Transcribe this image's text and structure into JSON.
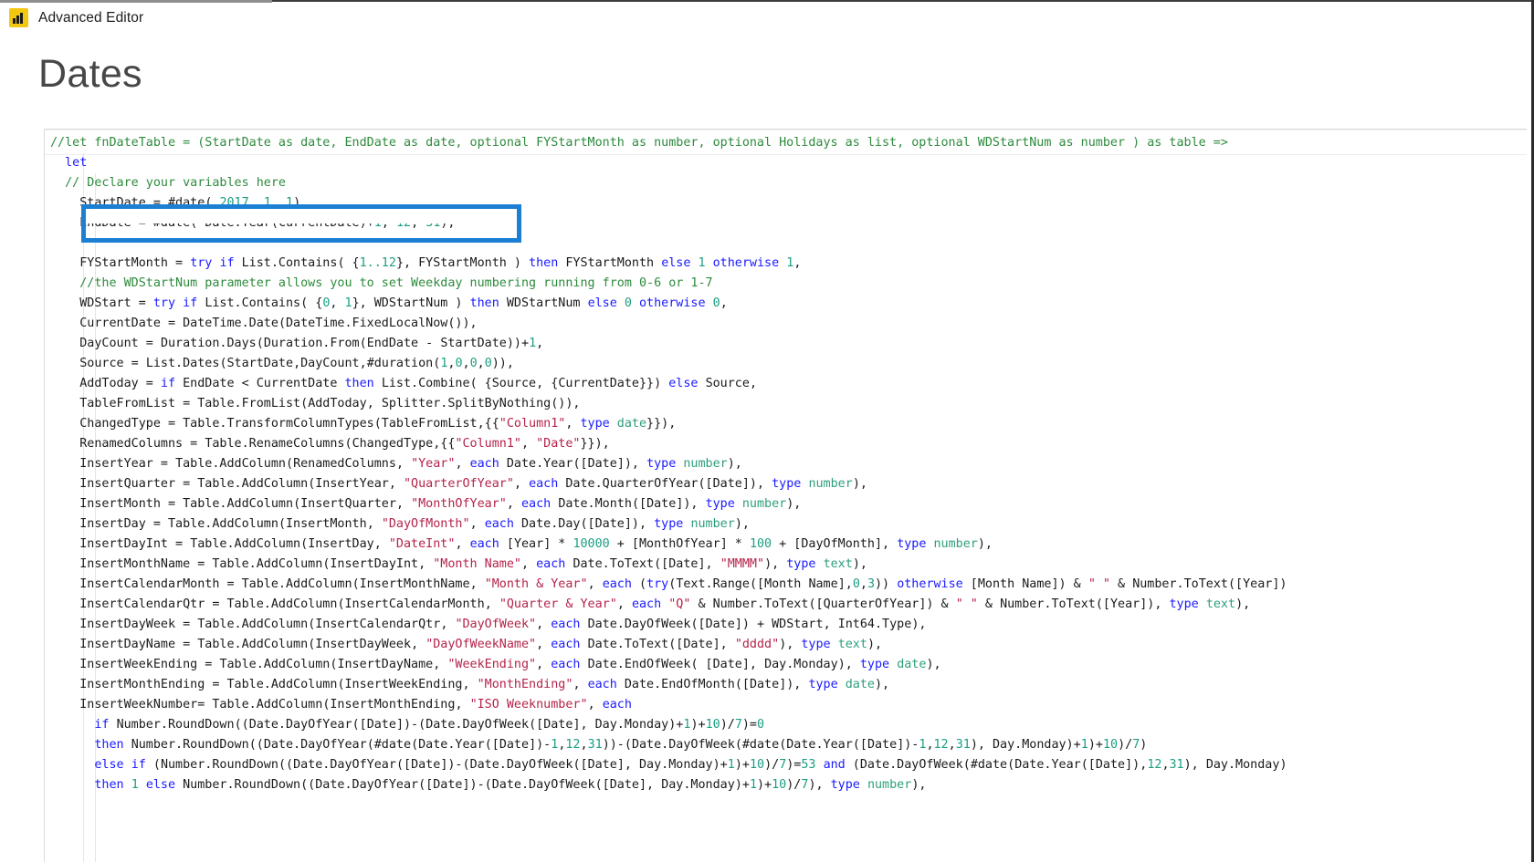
{
  "window": {
    "title": "Advanced Editor",
    "icon": "power-bi-icon",
    "accent_yellow": "#f2c811",
    "highlight_color": "#1b7fd3"
  },
  "dialog": {
    "heading": "Dates"
  },
  "editor": {
    "language": "M (Power Query)",
    "colors": {
      "keyword": "#1a1aff",
      "comment": "#2e8b3d",
      "string": "#b5234b",
      "number": "#1c9e84",
      "type": "#2e9e7d",
      "identifier": "#1a1a1a"
    },
    "highlighted_line_text": "EndDate = #date( Date.Year(CurrentDate)+1, 12, 31);",
    "lines": [
      "//let fnDateTable = (StartDate as date, EndDate as date, optional FYStartMonth as number, optional Holidays as list, optional WDStartNum as number ) as table =>",
      "  let",
      "  // Declare your variables here",
      "    StartDate = #date( 2017, 1, 1),",
      "    EndDate = #date( Date.Year(CurrentDate)+1, 12, 31);",
      "",
      "    FYStartMonth = try if List.Contains( {1..12}, FYStartMonth ) then FYStartMonth else 1 otherwise 1,",
      "    //the WDStartNum parameter allows you to set Weekday numbering running from 0-6 or 1-7",
      "    WDStart = try if List.Contains( {0, 1}, WDStartNum ) then WDStartNum else 0 otherwise 0,",
      "    CurrentDate = DateTime.Date(DateTime.FixedLocalNow()),",
      "    DayCount = Duration.Days(Duration.From(EndDate - StartDate))+1,",
      "    Source = List.Dates(StartDate,DayCount,#duration(1,0,0,0)),",
      "    AddToday = if EndDate < CurrentDate then List.Combine( {Source, {CurrentDate}}) else Source,",
      "    TableFromList = Table.FromList(AddToday, Splitter.SplitByNothing()),",
      "    ChangedType = Table.TransformColumnTypes(TableFromList,{{\"Column1\", type date}}),",
      "    RenamedColumns = Table.RenameColumns(ChangedType,{{\"Column1\", \"Date\"}}),",
      "    InsertYear = Table.AddColumn(RenamedColumns, \"Year\", each Date.Year([Date]), type number),",
      "    InsertQuarter = Table.AddColumn(InsertYear, \"QuarterOfYear\", each Date.QuarterOfYear([Date]), type number),",
      "    InsertMonth = Table.AddColumn(InsertQuarter, \"MonthOfYear\", each Date.Month([Date]), type number),",
      "    InsertDay = Table.AddColumn(InsertMonth, \"DayOfMonth\", each Date.Day([Date]), type number),",
      "    InsertDayInt = Table.AddColumn(InsertDay, \"DateInt\", each [Year] * 10000 + [MonthOfYear] * 100 + [DayOfMonth], type number),",
      "    InsertMonthName = Table.AddColumn(InsertDayInt, \"Month Name\", each Date.ToText([Date], \"MMMM\"), type text),",
      "    InsertCalendarMonth = Table.AddColumn(InsertMonthName, \"Month & Year\", each (try(Text.Range([Month Name],0,3)) otherwise [Month Name]) & \" \" & Number.ToText([Year])",
      "    InsertCalendarQtr = Table.AddColumn(InsertCalendarMonth, \"Quarter & Year\", each \"Q\" & Number.ToText([QuarterOfYear]) & \" \" & Number.ToText([Year]), type text),",
      "    InsertDayWeek = Table.AddColumn(InsertCalendarQtr, \"DayOfWeek\", each Date.DayOfWeek([Date]) + WDStart, Int64.Type),",
      "    InsertDayName = Table.AddColumn(InsertDayWeek, \"DayOfWeekName\", each Date.ToText([Date], \"dddd\"), type text),",
      "    InsertWeekEnding = Table.AddColumn(InsertDayName, \"WeekEnding\", each Date.EndOfWeek( [Date], Day.Monday), type date),",
      "    InsertMonthEnding = Table.AddColumn(InsertWeekEnding, \"MonthEnding\", each Date.EndOfMonth([Date]), type date),",
      "    InsertWeekNumber= Table.AddColumn(InsertMonthEnding, \"ISO Weeknumber\", each",
      "      if Number.RoundDown((Date.DayOfYear([Date])-(Date.DayOfWeek([Date], Day.Monday)+1)+10)/7)=0",
      "      then Number.RoundDown((Date.DayOfYear(#date(Date.Year([Date])-1,12,31))-(Date.DayOfWeek(#date(Date.Year([Date])-1,12,31), Day.Monday)+1)+10)/7)",
      "      else if (Number.RoundDown((Date.DayOfYear([Date])-(Date.DayOfWeek([Date], Day.Monday)+1)+10)/7)=53 and (Date.DayOfWeek(#date(Date.Year([Date]),12,31), Day.Monday)",
      "      then 1 else Number.RoundDown((Date.DayOfYear([Date])-(Date.DayOfWeek([Date], Day.Monday)+1)+10)/7), type number),"
    ]
  }
}
